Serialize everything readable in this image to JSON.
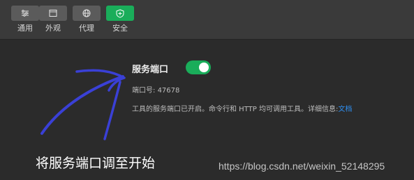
{
  "toolbar": {
    "items": [
      {
        "label": "通用",
        "icon": "sliders-icon",
        "active": false
      },
      {
        "label": "外观",
        "icon": "window-icon",
        "active": false
      },
      {
        "label": "代理",
        "icon": "globe-icon",
        "active": false
      },
      {
        "label": "安全",
        "icon": "shield-icon",
        "active": true
      }
    ]
  },
  "setting": {
    "title": "服务端口",
    "enabled": true,
    "port_label": "端口号:",
    "port_value": "47678",
    "status_text": "工具的服务端口已开启。命令行和 HTTP 均可调用工具。详细信息:",
    "doc_link": "文档"
  },
  "annotation": {
    "text": "将服务端口调至开始",
    "arrow_color": "#3a40d6"
  },
  "watermark": "https://blog.csdn.net/weixin_52148295",
  "colors": {
    "background": "#2b2b2b",
    "toolbar": "#3a3a3a",
    "accent": "#1aad5a",
    "link": "#2f8ff0"
  }
}
